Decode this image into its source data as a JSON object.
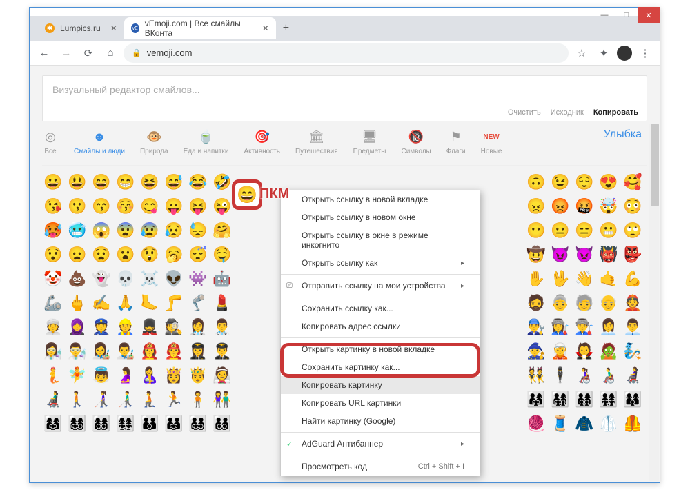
{
  "window": {
    "tabs": [
      {
        "favicon_color": "#f39c12",
        "title": "Lumpics.ru",
        "active": false
      },
      {
        "favicon_color": "#2a5db0",
        "favicon_letter": "vE",
        "title": "vEmoji.com | Все смайлы ВКонта",
        "active": true
      }
    ]
  },
  "address_bar": {
    "url": "vemoji.com"
  },
  "editor": {
    "placeholder": "Визуальный редактор смайлов...",
    "actions": {
      "clear": "Очистить",
      "source": "Исходник",
      "copy": "Копировать"
    }
  },
  "categories": [
    {
      "id": "all",
      "icon": "◎",
      "label": "Все"
    },
    {
      "id": "people",
      "icon": "☻",
      "label": "Смайлы и люди",
      "active": true
    },
    {
      "id": "nature",
      "icon": "🐵",
      "label": "Природа"
    },
    {
      "id": "food",
      "icon": "🍵",
      "label": "Еда и напитки"
    },
    {
      "id": "activity",
      "icon": "🎯",
      "label": "Активность"
    },
    {
      "id": "travel",
      "icon": "🏛",
      "label": "Путешествия"
    },
    {
      "id": "objects",
      "icon": "🖥",
      "label": "Предметы"
    },
    {
      "id": "symbols",
      "icon": "🔞",
      "label": "Символы"
    },
    {
      "id": "flags",
      "icon": "⚑",
      "label": "Флаги"
    },
    {
      "id": "new",
      "icon": "NEW",
      "label": "Новые"
    }
  ],
  "category_title": "Улыбка",
  "target_emoji": "😄",
  "pkm_label": "ПКМ",
  "context_menu": [
    {
      "type": "item",
      "label": "Открыть ссылку в новой вкладке"
    },
    {
      "type": "item",
      "label": "Открыть ссылку в новом окне"
    },
    {
      "type": "item",
      "label": "Открыть ссылку в окне в режиме инкогнито"
    },
    {
      "type": "item",
      "label": "Открыть ссылку как",
      "submenu": true
    },
    {
      "type": "sep"
    },
    {
      "type": "item",
      "label": "Отправить ссылку на мои устройства",
      "submenu": true,
      "icon": "⎚"
    },
    {
      "type": "sep"
    },
    {
      "type": "item",
      "label": "Сохранить ссылку как..."
    },
    {
      "type": "item",
      "label": "Копировать адрес ссылки"
    },
    {
      "type": "sep"
    },
    {
      "type": "item",
      "label": "Открыть картинку в новой вкладке"
    },
    {
      "type": "item",
      "label": "Сохранить картинку как..."
    },
    {
      "type": "item",
      "label": "Копировать картинку",
      "highlighted": true
    },
    {
      "type": "item",
      "label": "Копировать URL картинки"
    },
    {
      "type": "item",
      "label": "Найти картинку (Google)"
    },
    {
      "type": "sep"
    },
    {
      "type": "item",
      "label": "AdGuard Антибаннер",
      "submenu": true,
      "icon": "✓",
      "icon_color": "#2ecc71"
    },
    {
      "type": "sep"
    },
    {
      "type": "item",
      "label": "Просмотреть код",
      "shortcut": "Ctrl + Shift + I"
    }
  ],
  "emoji_rows": [
    [
      "😀",
      "😃",
      "😄",
      "😁",
      "😆",
      "😅",
      "😂",
      "🤣",
      "",
      "",
      "",
      "",
      "",
      "",
      "",
      "",
      "",
      "",
      "",
      "",
      "🙃",
      "😉",
      "😌",
      "😍",
      "🥰"
    ],
    [
      "😘",
      "😗",
      "😙",
      "😚",
      "😋",
      "😛",
      "😝",
      "😜",
      "",
      "",
      "",
      "",
      "",
      "",
      "",
      "",
      "",
      "",
      "",
      "",
      "😠",
      "😡",
      "🤬",
      "🤯",
      "😳"
    ],
    [
      "🥵",
      "🥶",
      "😱",
      "😨",
      "😰",
      "😥",
      "😓",
      "🤗",
      "",
      "",
      "",
      "",
      "",
      "",
      "",
      "",
      "",
      "",
      "",
      "",
      "😶",
      "😐",
      "😑",
      "😬",
      "🙄"
    ],
    [
      "😯",
      "😦",
      "😧",
      "😮",
      "😲",
      "🥱",
      "😴",
      "🤤",
      "",
      "",
      "",
      "",
      "",
      "",
      "",
      "",
      "",
      "",
      "",
      "",
      "🤠",
      "😈",
      "👿",
      "👹",
      "👺"
    ],
    [
      "🤡",
      "💩",
      "👻",
      "💀",
      "☠️",
      "👽",
      "👾",
      "🤖",
      "",
      "",
      "",
      "",
      "",
      "",
      "",
      "",
      "",
      "",
      "",
      "",
      "✋",
      "🖖",
      "👋",
      "🤙",
      "💪"
    ],
    [
      "🦾",
      "🖕",
      "✍️",
      "🙏",
      "🦶",
      "🦵",
      "🦿",
      "💄",
      "",
      "",
      "",
      "",
      "",
      "",
      "",
      "",
      "",
      "",
      "",
      "",
      "🧔",
      "👵",
      "🧓",
      "👴",
      "👲"
    ],
    [
      "👳",
      "🧕",
      "👮",
      "👷",
      "💂",
      "🕵️",
      "👩‍⚕️",
      "👨‍⚕️",
      "",
      "",
      "",
      "",
      "",
      "",
      "",
      "",
      "",
      "",
      "",
      "",
      "👨‍🔧",
      "👩‍🏭",
      "👨‍🏭",
      "👩‍💼",
      "👨‍💼"
    ],
    [
      "👩‍🔬",
      "👨‍🔬",
      "👩‍🎨",
      "👨‍🎨",
      "👩‍🚒",
      "👨‍🚒",
      "👩‍✈️",
      "👨‍✈️",
      "",
      "",
      "",
      "",
      "",
      "",
      "",
      "",
      "",
      "",
      "",
      "",
      "🧙",
      "🧝",
      "🧛",
      "🧟",
      "🧞"
    ],
    [
      "🧜",
      "🧚",
      "👼",
      "🤰",
      "🤱",
      "👸",
      "🤴",
      "👰",
      "",
      "",
      "",
      "",
      "",
      "",
      "",
      "",
      "",
      "",
      "",
      "",
      "👯",
      "🕴️",
      "👩‍🦽",
      "👨‍🦽",
      "👩‍🦼"
    ],
    [
      "👨‍🦼",
      "🚶",
      "👩‍🦯",
      "👨‍🦯",
      "🧎",
      "🏃",
      "🧍",
      "👫",
      "",
      "",
      "",
      "",
      "",
      "",
      "",
      "",
      "",
      "",
      "",
      "",
      "👨‍👩‍👧",
      "👨‍👩‍👧‍👦",
      "👨‍👩‍👦‍👦",
      "👨‍👩‍👧‍👧",
      "👩‍👩‍👦"
    ],
    [
      "👩‍👩‍👧",
      "👩‍👩‍👧‍👦",
      "👩‍👩‍👦‍👦",
      "👩‍👩‍👧‍👧",
      "👨‍👨‍👦",
      "👨‍👨‍👧",
      "👨‍👨‍👧‍👦",
      "👨‍👨‍👦‍👦",
      "",
      "",
      "",
      "",
      "",
      "",
      "",
      "",
      "",
      "",
      "",
      "",
      "🧶",
      "🧵",
      "🧥",
      "🥼",
      "🦺"
    ]
  ]
}
